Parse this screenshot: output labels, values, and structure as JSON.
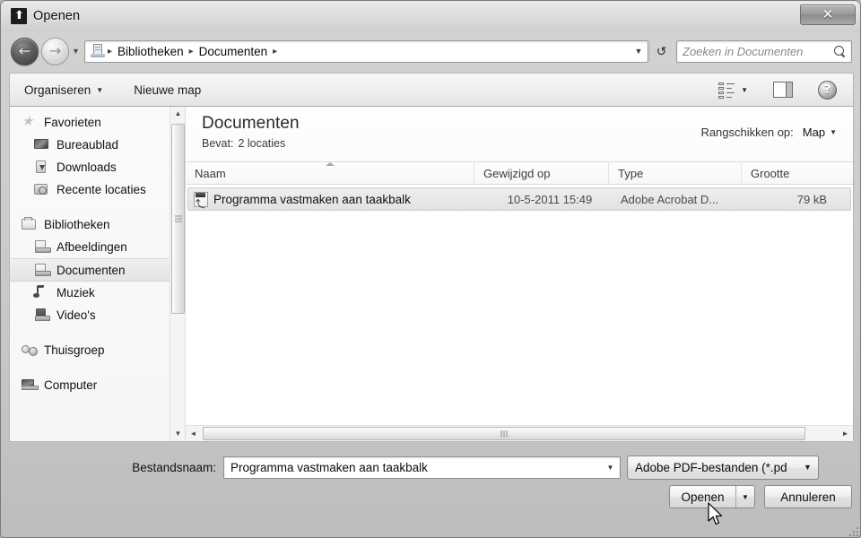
{
  "window": {
    "title": "Openen",
    "title_icon": "adobe-acrobat-icon",
    "close_label": "✕"
  },
  "address_bar": {
    "back_arrow": "←",
    "forward_arrow": "→",
    "history_caret": "▼",
    "crumbs": [
      {
        "label": "Bibliotheken"
      },
      {
        "label": "Documenten"
      }
    ],
    "separator": "▸",
    "dropdown_caret": "▼",
    "refresh_glyph": "↺",
    "search_placeholder": "Zoeken in Documenten"
  },
  "toolbar": {
    "organize_label": "Organiseren",
    "organize_caret": "▼",
    "new_folder_label": "Nieuwe map",
    "view_caret": "▼",
    "help_glyph": "?"
  },
  "sidebar": {
    "groups": [
      {
        "header": {
          "label": "Favorieten",
          "icon": "star-icon",
          "icon_class": "ic-star"
        },
        "items": [
          {
            "label": "Bureaublad",
            "icon": "desktop-icon",
            "icon_class": "ic-desk"
          },
          {
            "label": "Downloads",
            "icon": "downloads-icon",
            "icon_class": "ic-dl"
          },
          {
            "label": "Recente locaties",
            "icon": "recent-locations-icon",
            "icon_class": "ic-recent"
          }
        ]
      },
      {
        "header": {
          "label": "Bibliotheken",
          "icon": "libraries-icon",
          "icon_class": "ic-lib"
        },
        "items": [
          {
            "label": "Afbeeldingen",
            "icon": "pictures-icon",
            "icon_class": "ic-folderdoc"
          },
          {
            "label": "Documenten",
            "icon": "documents-icon",
            "icon_class": "ic-folderdoc",
            "selected": true
          },
          {
            "label": "Muziek",
            "icon": "music-icon",
            "icon_class": "ic-note"
          },
          {
            "label": "Video's",
            "icon": "videos-icon",
            "icon_class": "ic-vid"
          }
        ]
      },
      {
        "header": {
          "label": "Thuisgroep",
          "icon": "homegroup-icon",
          "icon_class": "ic-home"
        },
        "items": []
      },
      {
        "header": {
          "label": "Computer",
          "icon": "computer-icon",
          "icon_class": "ic-pc"
        },
        "items": []
      }
    ],
    "scroll_up": "▲",
    "scroll_down": "▼"
  },
  "content": {
    "heading": "Documenten",
    "subtitle_label": "Bevat:",
    "subtitle_value": "2 locaties",
    "arrange_label": "Rangschikken op:",
    "arrange_value": "Map",
    "arrange_caret": "▼",
    "columns": [
      {
        "label": "Naam",
        "key": "name",
        "sorted": true
      },
      {
        "label": "Gewijzigd op",
        "key": "modified"
      },
      {
        "label": "Type",
        "key": "type"
      },
      {
        "label": "Grootte",
        "key": "size"
      }
    ],
    "rows": [
      {
        "icon": "pdf-file-icon",
        "name": "Programma vastmaken aan taakbalk",
        "modified": "10-5-2011 15:49",
        "type": "Adobe Acrobat D...",
        "size": "79 kB",
        "selected": true
      }
    ]
  },
  "scrollbars": {
    "h_left": "◄",
    "h_right": "►"
  },
  "footer": {
    "filename_label": "Bestandsnaam:",
    "filename_value": "Programma vastmaken aan taakbalk",
    "filename_caret": "▼",
    "filter_value": "Adobe PDF-bestanden (*.pd",
    "filter_caret": "▼",
    "open_label": "Openen",
    "open_caret": "▼",
    "cancel_label": "Annuleren"
  },
  "colors": {
    "window_frame": "#c8c8c8",
    "pane_background": "#ffffff",
    "selection": "#e6e6e6",
    "text": "#111111",
    "muted_text": "#4a4a4a"
  }
}
